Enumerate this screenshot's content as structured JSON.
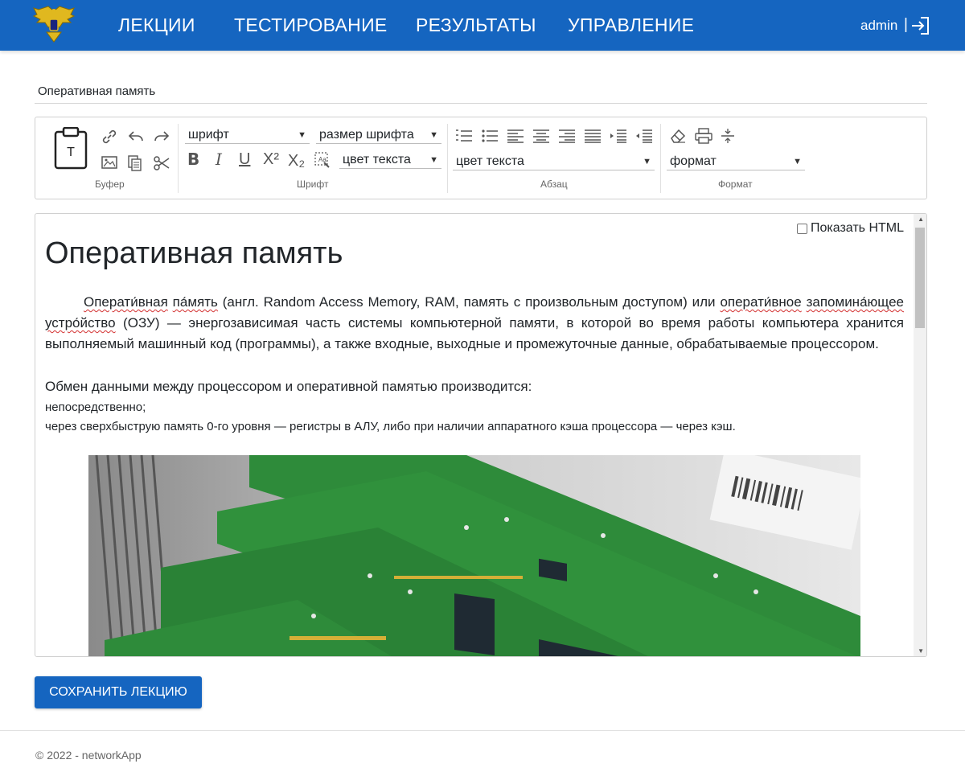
{
  "nav": {
    "links": [
      "ЛЕКЦИИ",
      "ТЕСТИРОВАНИЕ",
      "РЕЗУЛЬТАТЫ",
      "УПРАВЛЕНИЕ"
    ],
    "user": "admin",
    "separator": "|",
    "logo_icon": "eagle-emblem-icon",
    "logout_icon": "logout-icon"
  },
  "title_input": {
    "value": "Оперативная память"
  },
  "toolbar": {
    "groups": [
      "Буфер",
      "Шрифт",
      "Абзац",
      "Формат"
    ],
    "font_select": "шрифт",
    "font_size_select": "размер шрифта",
    "text_color_select": "цвет текста",
    "paragraph_color_select": "цвет текста",
    "format_select": "формат",
    "superscript_label": "X²",
    "subscript_label": "X₂"
  },
  "editor": {
    "show_html_label": "Показать HTML",
    "heading": "Оперативная память",
    "paragraph": {
      "w1": "Операти́вная",
      "w2": "па́мять",
      "t1": " (англ. Random Access Memory, RAM, память с произвольным доступом) или ",
      "w3": "операти́вное",
      "w4": "запомина́ющее",
      "w5": "устро́йство",
      "t2": " (ОЗУ) — энергозависимая часть системы компьютерной памяти, в которой во время работы компьютера хранится выполняемый машинный код (программы), а также входные, выходные и промежуточные данные, обрабатываемые процессором."
    },
    "exchange_line": "Обмен данными между процессором и оперативной памятью производится:",
    "item1": "непосредственно;",
    "item2": "через сверхбыструю память 0-го уровня — регистры в АЛУ, либо при наличии аппаратного кэша процессора — через кэш."
  },
  "save_button": "СОХРАНИТЬ ЛЕКЦИЮ",
  "footer": "© 2022 - networkApp",
  "colors": {
    "primary": "#1565c0",
    "spellcheck": "#d32f2f",
    "pcb_green": "#2e8b3a"
  }
}
